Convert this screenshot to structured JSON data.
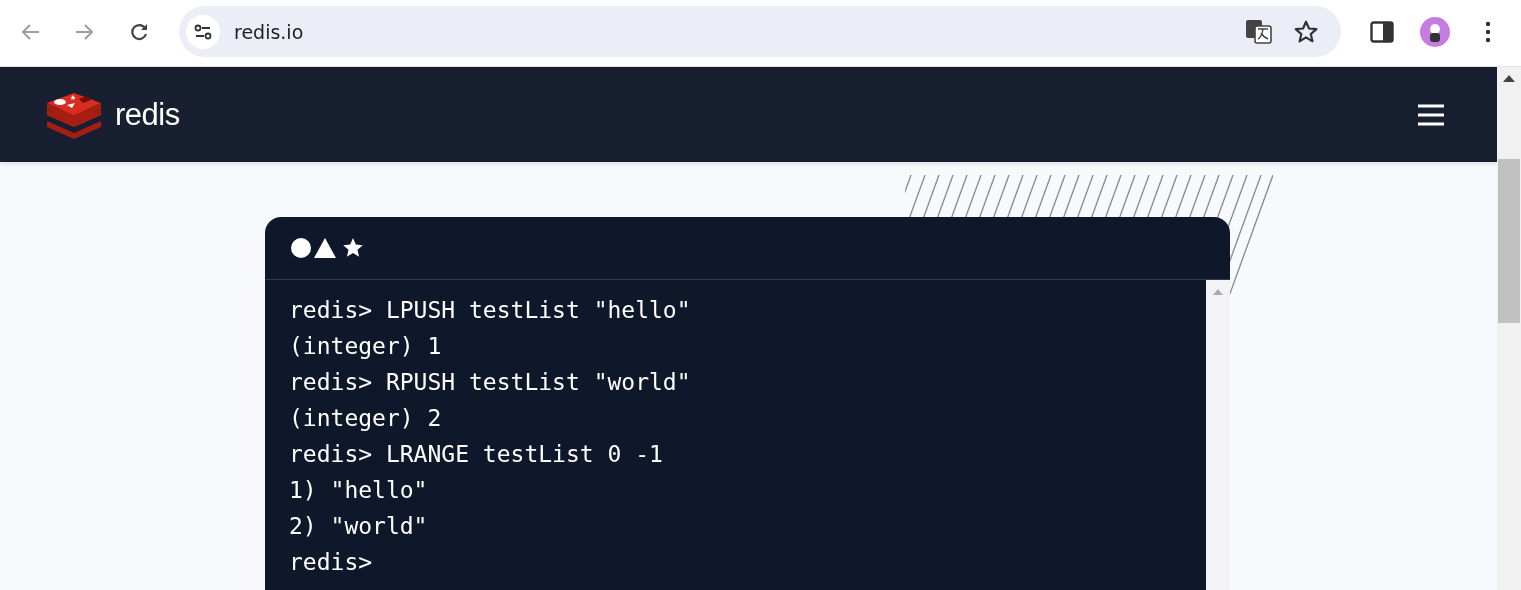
{
  "browser": {
    "url": "redis.io"
  },
  "site_header": {
    "logo_text": "redis"
  },
  "terminal": {
    "lines": [
      "redis> LPUSH testList \"hello\"",
      "(integer) 1",
      "redis> RPUSH testList \"world\"",
      "(integer) 2",
      "redis> LRANGE testList 0 -1",
      "1) \"hello\"",
      "2) \"world\"",
      "redis> "
    ]
  }
}
